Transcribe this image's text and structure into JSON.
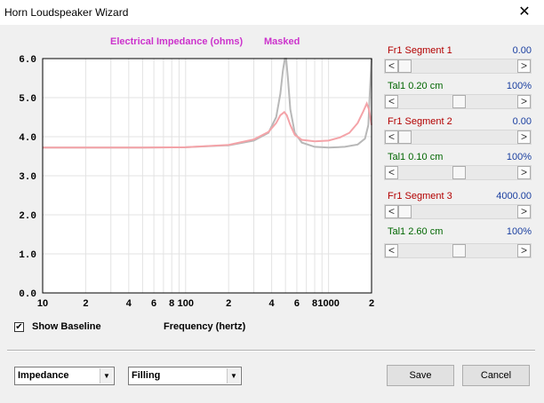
{
  "window": {
    "title": "Horn Loudspeaker Wizard",
    "close_glyph": "✕"
  },
  "chart_data": {
    "type": "line",
    "title": "Electrical Impedance (ohms)",
    "subtitle": "Masked",
    "xlabel": "Frequency (hertz)",
    "ylabel": "",
    "x_scale": "log",
    "xlim": [
      10,
      2000
    ],
    "ylim": [
      0,
      6
    ],
    "yticks": [
      "0.0",
      "1.0",
      "2.0",
      "3.0",
      "4.0",
      "5.0",
      "6.0"
    ],
    "xticks": [
      {
        "value": 10,
        "label": "10"
      },
      {
        "value": 20,
        "label": "2"
      },
      {
        "value": 40,
        "label": "4"
      },
      {
        "value": 60,
        "label": "6"
      },
      {
        "value": 80,
        "label": "8"
      },
      {
        "value": 100,
        "label": "100"
      },
      {
        "value": 200,
        "label": "2"
      },
      {
        "value": 400,
        "label": "4"
      },
      {
        "value": 600,
        "label": "6"
      },
      {
        "value": 800,
        "label": "8"
      },
      {
        "value": 1000,
        "label": "1000"
      },
      {
        "value": 2000,
        "label": "2"
      }
    ],
    "grid": true,
    "colors": {
      "title": "#cc33cc",
      "baseline": "#b8b8b8",
      "masked": "#f4a3a8",
      "grid": "#e3e3e3",
      "axis": "#000000"
    },
    "series": [
      {
        "id": "baseline",
        "x": [
          10,
          20,
          50,
          100,
          200,
          300,
          380,
          430,
          460,
          480,
          495,
          505,
          520,
          540,
          580,
          650,
          800,
          1000,
          1300,
          1600,
          1800,
          1900,
          1950,
          2000
        ],
        "y": [
          3.72,
          3.72,
          3.72,
          3.73,
          3.78,
          3.9,
          4.1,
          4.5,
          5.1,
          5.7,
          6.0,
          6.0,
          5.5,
          4.7,
          4.1,
          3.85,
          3.74,
          3.72,
          3.74,
          3.8,
          3.95,
          4.3,
          5.2,
          6.0
        ]
      },
      {
        "id": "masked",
        "x": [
          10,
          20,
          50,
          100,
          200,
          300,
          380,
          430,
          460,
          490,
          510,
          540,
          580,
          650,
          800,
          1000,
          1200,
          1400,
          1600,
          1750,
          1850,
          1920,
          1980,
          2000
        ],
        "y": [
          3.72,
          3.72,
          3.72,
          3.73,
          3.79,
          3.93,
          4.12,
          4.35,
          4.55,
          4.63,
          4.55,
          4.3,
          4.05,
          3.92,
          3.88,
          3.9,
          3.98,
          4.1,
          4.35,
          4.65,
          4.85,
          4.7,
          4.4,
          4.3
        ]
      }
    ]
  },
  "controls": {
    "show_baseline": {
      "label": "Show Baseline",
      "checked": true,
      "check_glyph": "✔"
    },
    "segments": [
      {
        "label": "Fr1  Segment 1",
        "value": "0.00",
        "slider_value": 0.0
      },
      {
        "label": "Tal1  0.20 cm",
        "value": "100%",
        "slider_value": 0.5
      },
      {
        "label": "Fr1  Segment 2",
        "value": "0.00",
        "slider_value": 0.0
      },
      {
        "label": "Tal1  0.10 cm",
        "value": "100%",
        "slider_value": 0.5
      },
      {
        "label": "Fr1  Segment 3",
        "value": "4000.00",
        "slider_value": 0.0
      },
      {
        "label": "Tal1  2.60 cm",
        "value": "100%",
        "slider_value": 0.5
      }
    ],
    "arrow_left": "<",
    "arrow_right": ">"
  },
  "bottom": {
    "plot_select": {
      "value": "Impedance",
      "arrow": "▼"
    },
    "filling_select": {
      "value": "Filling",
      "arrow": "▼"
    },
    "save_label": "Save",
    "cancel_label": "Cancel"
  }
}
